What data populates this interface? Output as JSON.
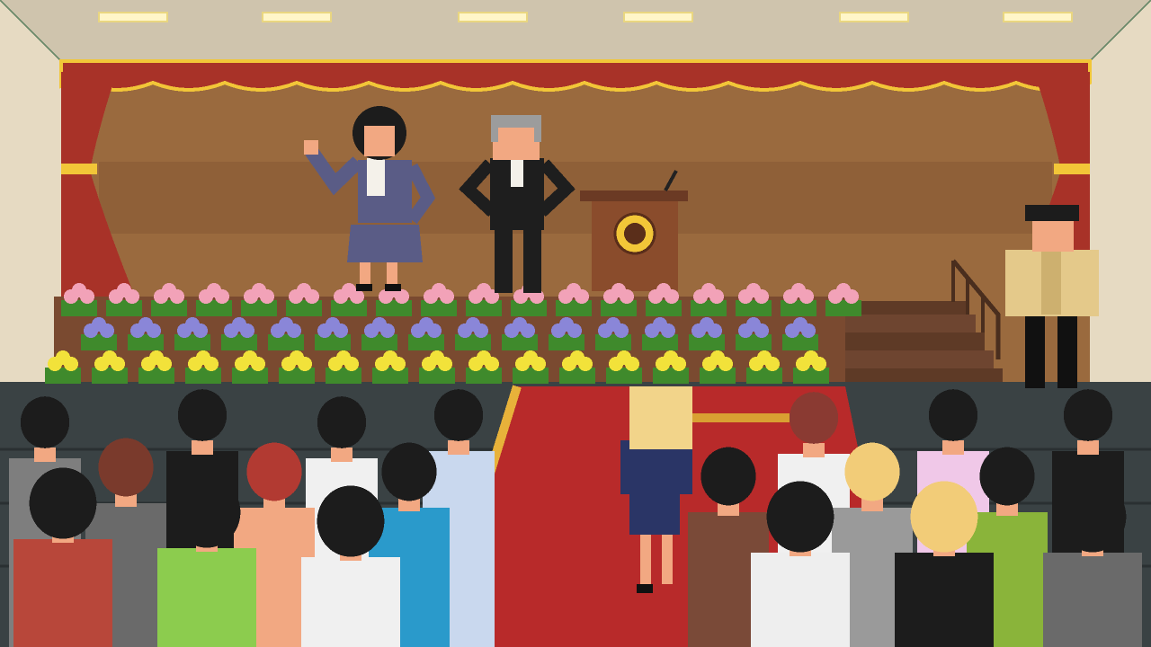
{
  "game": {
    "scene": "auditorium-ceremony",
    "visible_text": []
  },
  "colors": {
    "ceiling": "#cfc4ad",
    "wall": "#e6dac2",
    "curtain": "#a83228",
    "curtain_trim": "#f2c638",
    "backdrop": "#9a6a3e",
    "stage_front": "#7a4a30",
    "carpet": "#b82a2a",
    "carpet_border": "#e8b23a",
    "floor": "#3a4244",
    "skin": "#f2a882",
    "hair_black": "#1c1c1c"
  },
  "stage": {
    "podium_emblem": "crest-emblem",
    "flower_rows": [
      "pink",
      "purple",
      "yellow"
    ]
  },
  "characters": [
    {
      "id": "woman-purple-suit",
      "role": "speaker-waving"
    },
    {
      "id": "old-man-black-suit",
      "role": "speaker"
    },
    {
      "id": "man-barong-side",
      "role": "side-stage"
    }
  ],
  "audience": {
    "walker": "blonde-woman-navy-suit"
  }
}
